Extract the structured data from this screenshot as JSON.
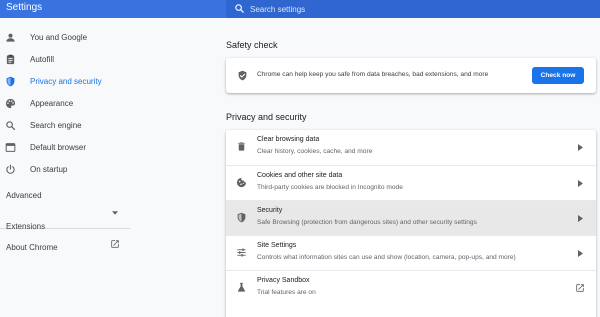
{
  "header": {
    "title": "Settings",
    "search_placeholder": "Search settings"
  },
  "sidebar": {
    "items": [
      {
        "label": "You and Google",
        "icon": "person-icon"
      },
      {
        "label": "Autofill",
        "icon": "clipboard-icon"
      },
      {
        "label": "Privacy and security",
        "icon": "shield-icon",
        "active": true
      },
      {
        "label": "Appearance",
        "icon": "palette-icon"
      },
      {
        "label": "Search engine",
        "icon": "search-icon"
      },
      {
        "label": "Default browser",
        "icon": "browser-icon"
      },
      {
        "label": "On startup",
        "icon": "power-icon"
      }
    ],
    "advanced_label": "Advanced",
    "extensions_label": "Extensions",
    "about_label": "About Chrome"
  },
  "main": {
    "safety_check": {
      "title": "Safety check",
      "description": "Chrome can help keep you safe from data breaches, bad extensions, and more",
      "button_label": "Check now"
    },
    "privacy": {
      "title": "Privacy and security",
      "rows": [
        {
          "title": "Clear browsing data",
          "subtitle": "Clear history, cookies, cache, and more",
          "icon": "trash-icon"
        },
        {
          "title": "Cookies and other site data",
          "subtitle": "Third-party cookies are blocked in Incognito mode",
          "icon": "cookie-icon"
        },
        {
          "title": "Security",
          "subtitle": "Safe Browsing (protection from dangerous sites) and other security settings",
          "icon": "shield-icon"
        },
        {
          "title": "Site Settings",
          "subtitle": "Controls what information sites can use and show (location, camera, pop-ups, and more)",
          "icon": "sliders-icon"
        },
        {
          "title": "Privacy Sandbox",
          "subtitle": "Trial features are on",
          "icon": "flask-icon"
        }
      ]
    }
  },
  "colors": {
    "accent": "#1a73e8",
    "header": "#3873e0",
    "search_bg": "#2f66cf",
    "background": "#f8f9fa",
    "hover_row": "#e8e8e8"
  }
}
